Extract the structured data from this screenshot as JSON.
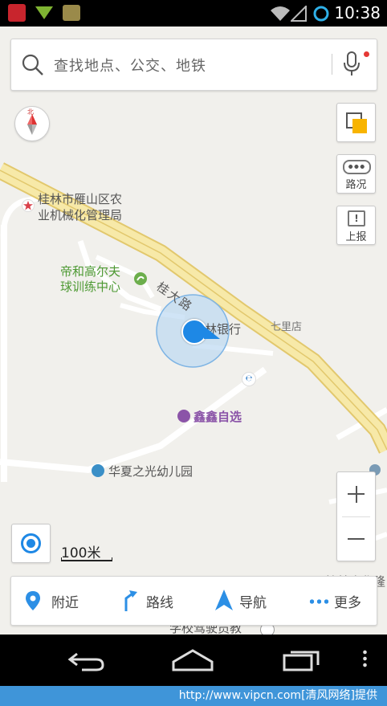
{
  "status": {
    "time": "10:38"
  },
  "search": {
    "placeholder": "查找地点、公交、地铁"
  },
  "map": {
    "labels": {
      "guilin_bureau_line1": "桂林市雁山区农",
      "guilin_bureau_line2": "业机械化管理局",
      "golf_line1": "帝和高尔夫",
      "golf_line2": "球训练中心",
      "road_guida": "桂大路",
      "bank": "林银行",
      "qilidian": "七里店",
      "xinxin": "鑫鑫自选",
      "kindergarten": "华夏之光幼儿园",
      "driving_school": "学校驾驶员教",
      "edge_label": "桂林广华隆"
    },
    "compass_letter": "北",
    "scale": "100米"
  },
  "side_buttons": {
    "traffic": "路况",
    "report": "上报"
  },
  "bottom_bar": {
    "nearby": "附近",
    "route": "路线",
    "navigation": "导航",
    "more": "更多"
  },
  "watermark": "http://www.vipcn.com[清风网络]提供",
  "colors": {
    "accent": "#2c8fe5",
    "road_fill": "#f7e9a8",
    "road_edge": "#e2c86d",
    "poi_green": "#4e9a34",
    "poi_purple": "#8b54a8"
  }
}
